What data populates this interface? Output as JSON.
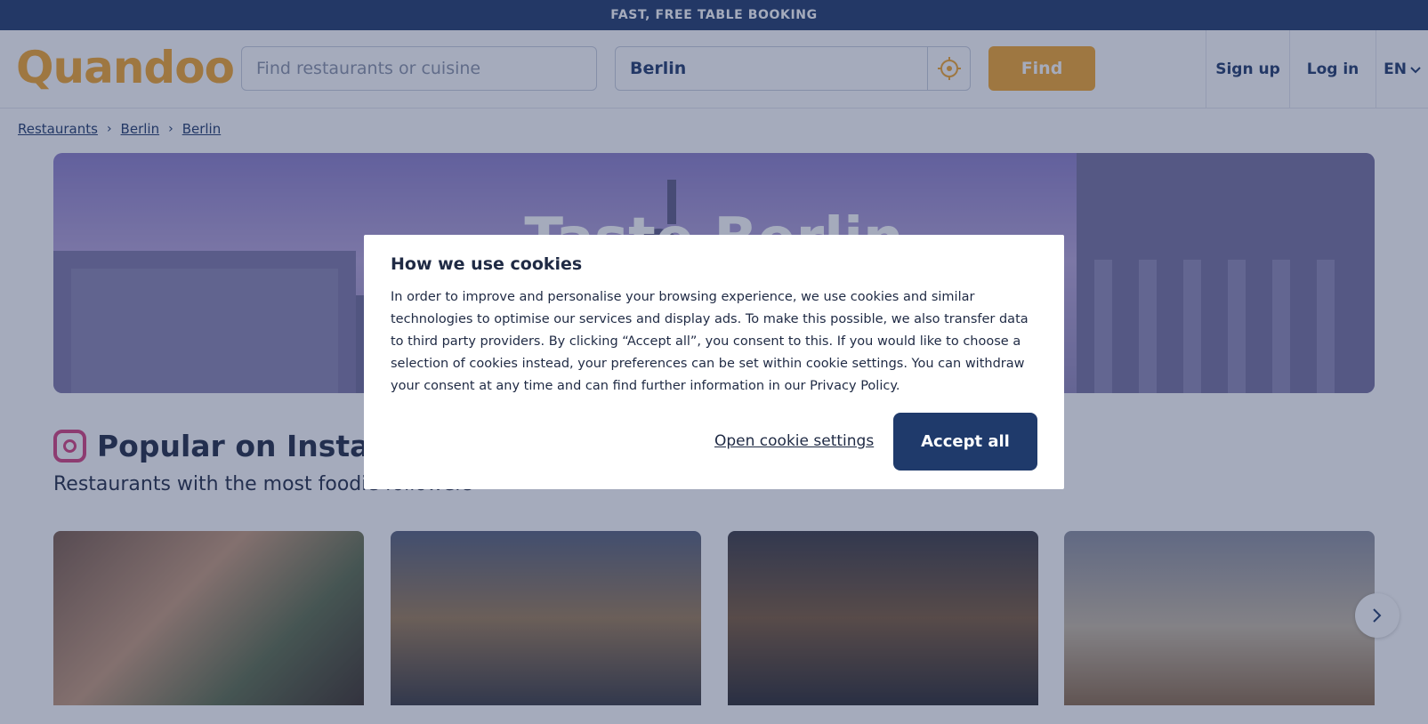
{
  "topbar": {
    "text": "FAST, FREE TABLE BOOKING"
  },
  "header": {
    "logo": "Quandoo",
    "search_placeholder": "Find restaurants or cuisine",
    "location_value": "Berlin",
    "find_label": "Find",
    "signup_label": "Sign up",
    "login_label": "Log in",
    "language_label": "EN"
  },
  "breadcrumb": [
    "Restaurants",
    "Berlin",
    "Berlin"
  ],
  "hero": {
    "title": "Taste Berlin"
  },
  "instagram": {
    "title": "Popular on Instagram",
    "subtitle": "Restaurants with the most foodie followers"
  },
  "cookie_modal": {
    "title": "How we use cookies",
    "body": "In order to improve and personalise your browsing experience, we use cookies and similar technologies to optimise our services and display ads. To make this possible, we also transfer data to third party providers. By clicking “Accept all”, you consent to this. If you would like to choose a selection of cookies instead, your preferences can be set within cookie settings. You can withdraw your consent at any time and can find further information in our Privacy Policy.",
    "settings_label": "Open cookie settings",
    "accept_label": "Accept all"
  },
  "colors": {
    "brand_orange": "#f3a52b",
    "brand_navy": "#1f3a6b"
  },
  "icons": {
    "location": "crosshair-icon",
    "language": "chevron-down-icon",
    "breadcrumb_sep": "chevron-right-icon",
    "next": "chevron-right-icon",
    "instagram": "instagram-icon"
  }
}
